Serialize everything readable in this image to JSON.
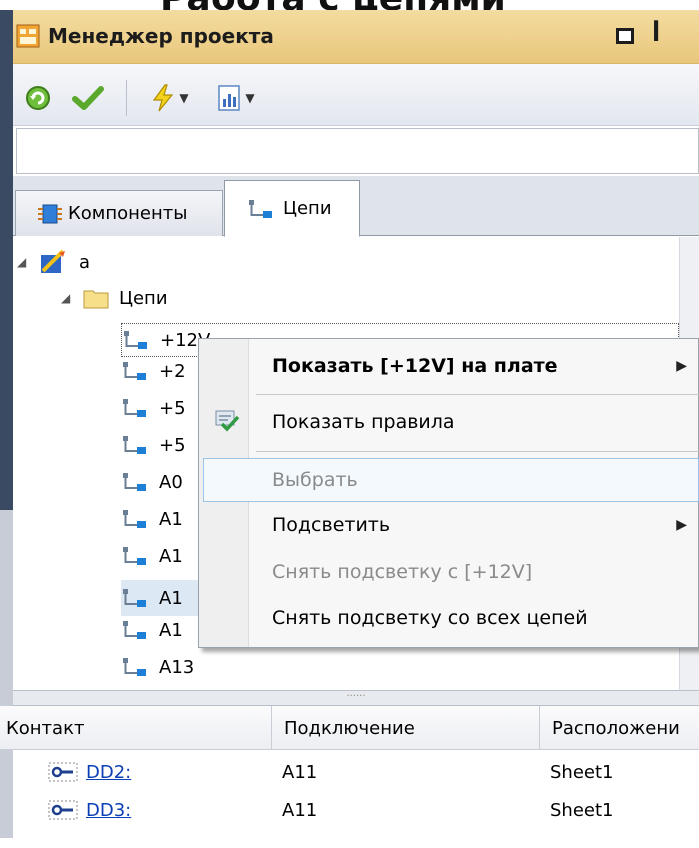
{
  "heading": {
    "text": "Работа с цепями"
  },
  "panel": {
    "title": "Менеджер проекта",
    "float_glyph": "",
    "pin_glyph": "ꟾ"
  },
  "toolbar": {
    "buttons": [
      {
        "icon": "refresh-icon"
      },
      {
        "icon": "check-icon"
      },
      {
        "icon": "lightning-icon"
      },
      {
        "icon": "report-icon"
      }
    ]
  },
  "search": {
    "value": "",
    "placeholder": ""
  },
  "tabs": [
    {
      "label": "Компоненты",
      "icon": "components-icon",
      "active": false
    },
    {
      "label": "Цепи",
      "icon": "net-icon",
      "active": true
    }
  ],
  "tree": {
    "root": "а",
    "folder": "Цепи",
    "nets": [
      "+12V",
      "+2",
      "+5",
      "+5",
      "A0",
      "A1",
      "A1",
      "A1",
      "A1",
      "A13"
    ]
  },
  "context_menu": {
    "items": [
      {
        "label": "Показать [+12V] на плате",
        "bold": true,
        "submenu": true,
        "disabled": false
      },
      {
        "label": "Показать правила",
        "bold": false,
        "submenu": false,
        "disabled": false,
        "icon": "rules-icon"
      },
      {
        "label": "Выбрать",
        "bold": false,
        "submenu": false,
        "disabled": true,
        "highlighted": true
      },
      {
        "label": "Подсветить",
        "bold": false,
        "submenu": true,
        "disabled": false
      },
      {
        "label": "Снять подсветку с [+12V]",
        "bold": false,
        "submenu": false,
        "disabled": true
      },
      {
        "label": "Снять подсветку со всех цепей",
        "bold": false,
        "submenu": false,
        "disabled": false
      }
    ]
  },
  "grid": {
    "columns": [
      "Контакт",
      "Подключение",
      "Расположени"
    ],
    "rows": [
      {
        "contact": "DD2:",
        "connection": "A11",
        "location": "Sheet1"
      },
      {
        "contact": "DD3:",
        "connection": "A11",
        "location": "Sheet1"
      }
    ]
  },
  "colors": {
    "title_bar": "#e9c77c",
    "menu_highlight": "#9cc4e8",
    "link": "#0b3fb5"
  }
}
